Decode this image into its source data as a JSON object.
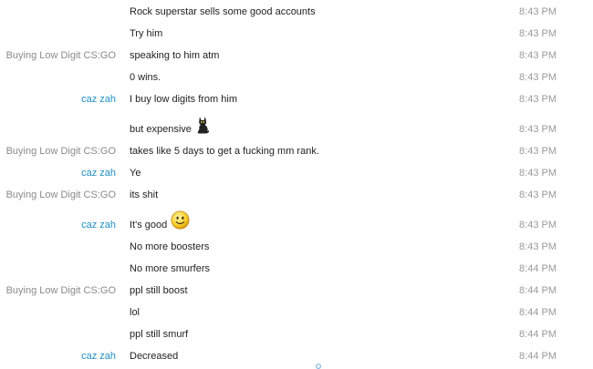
{
  "colors": {
    "sender_other": "#8a8a8a",
    "sender_self": "#1f8fc3",
    "message_text": "#1f1f1f",
    "timestamp": "#9a9a9a"
  },
  "messages": [
    {
      "sender": "",
      "text": "Rock superstar sells some good accounts",
      "time": "8:43 PM"
    },
    {
      "sender": "",
      "text": "Try him",
      "time": "8:43 PM"
    },
    {
      "sender": "Buying Low Digit CS:GO",
      "text": "speaking to him atm",
      "time": "8:43 PM"
    },
    {
      "sender": "",
      "text": "0 wins.",
      "time": "8:43 PM"
    },
    {
      "sender": "caz zah",
      "text": "I buy low digits from him",
      "time": "8:43 PM"
    },
    {
      "sender": "",
      "text": "but expensive",
      "time": "8:43 PM",
      "emoticon": "black-cat-icon"
    },
    {
      "sender": "Buying Low Digit CS:GO",
      "text": "takes like 5 days to get a fucking mm rank.",
      "time": "8:43 PM"
    },
    {
      "sender": "caz zah",
      "text": "Ye",
      "time": "8:43 PM"
    },
    {
      "sender": "Buying Low Digit CS:GO",
      "text": "its shit",
      "time": "8:43 PM"
    },
    {
      "sender": "caz zah",
      "text": "It's good",
      "time": "8:43 PM",
      "emoticon": "smiley-icon"
    },
    {
      "sender": "",
      "text": "No more boosters",
      "time": "8:43 PM"
    },
    {
      "sender": "",
      "text": "No more smurfers",
      "time": "8:44 PM"
    },
    {
      "sender": "Buying Low Digit CS:GO",
      "text": "ppl still boost",
      "time": "8:44 PM"
    },
    {
      "sender": "",
      "text": "lol",
      "time": "8:44 PM"
    },
    {
      "sender": "",
      "text": "ppl still smurf",
      "time": "8:44 PM"
    },
    {
      "sender": "caz zah",
      "text": "Decreased",
      "time": "8:44 PM"
    }
  ]
}
